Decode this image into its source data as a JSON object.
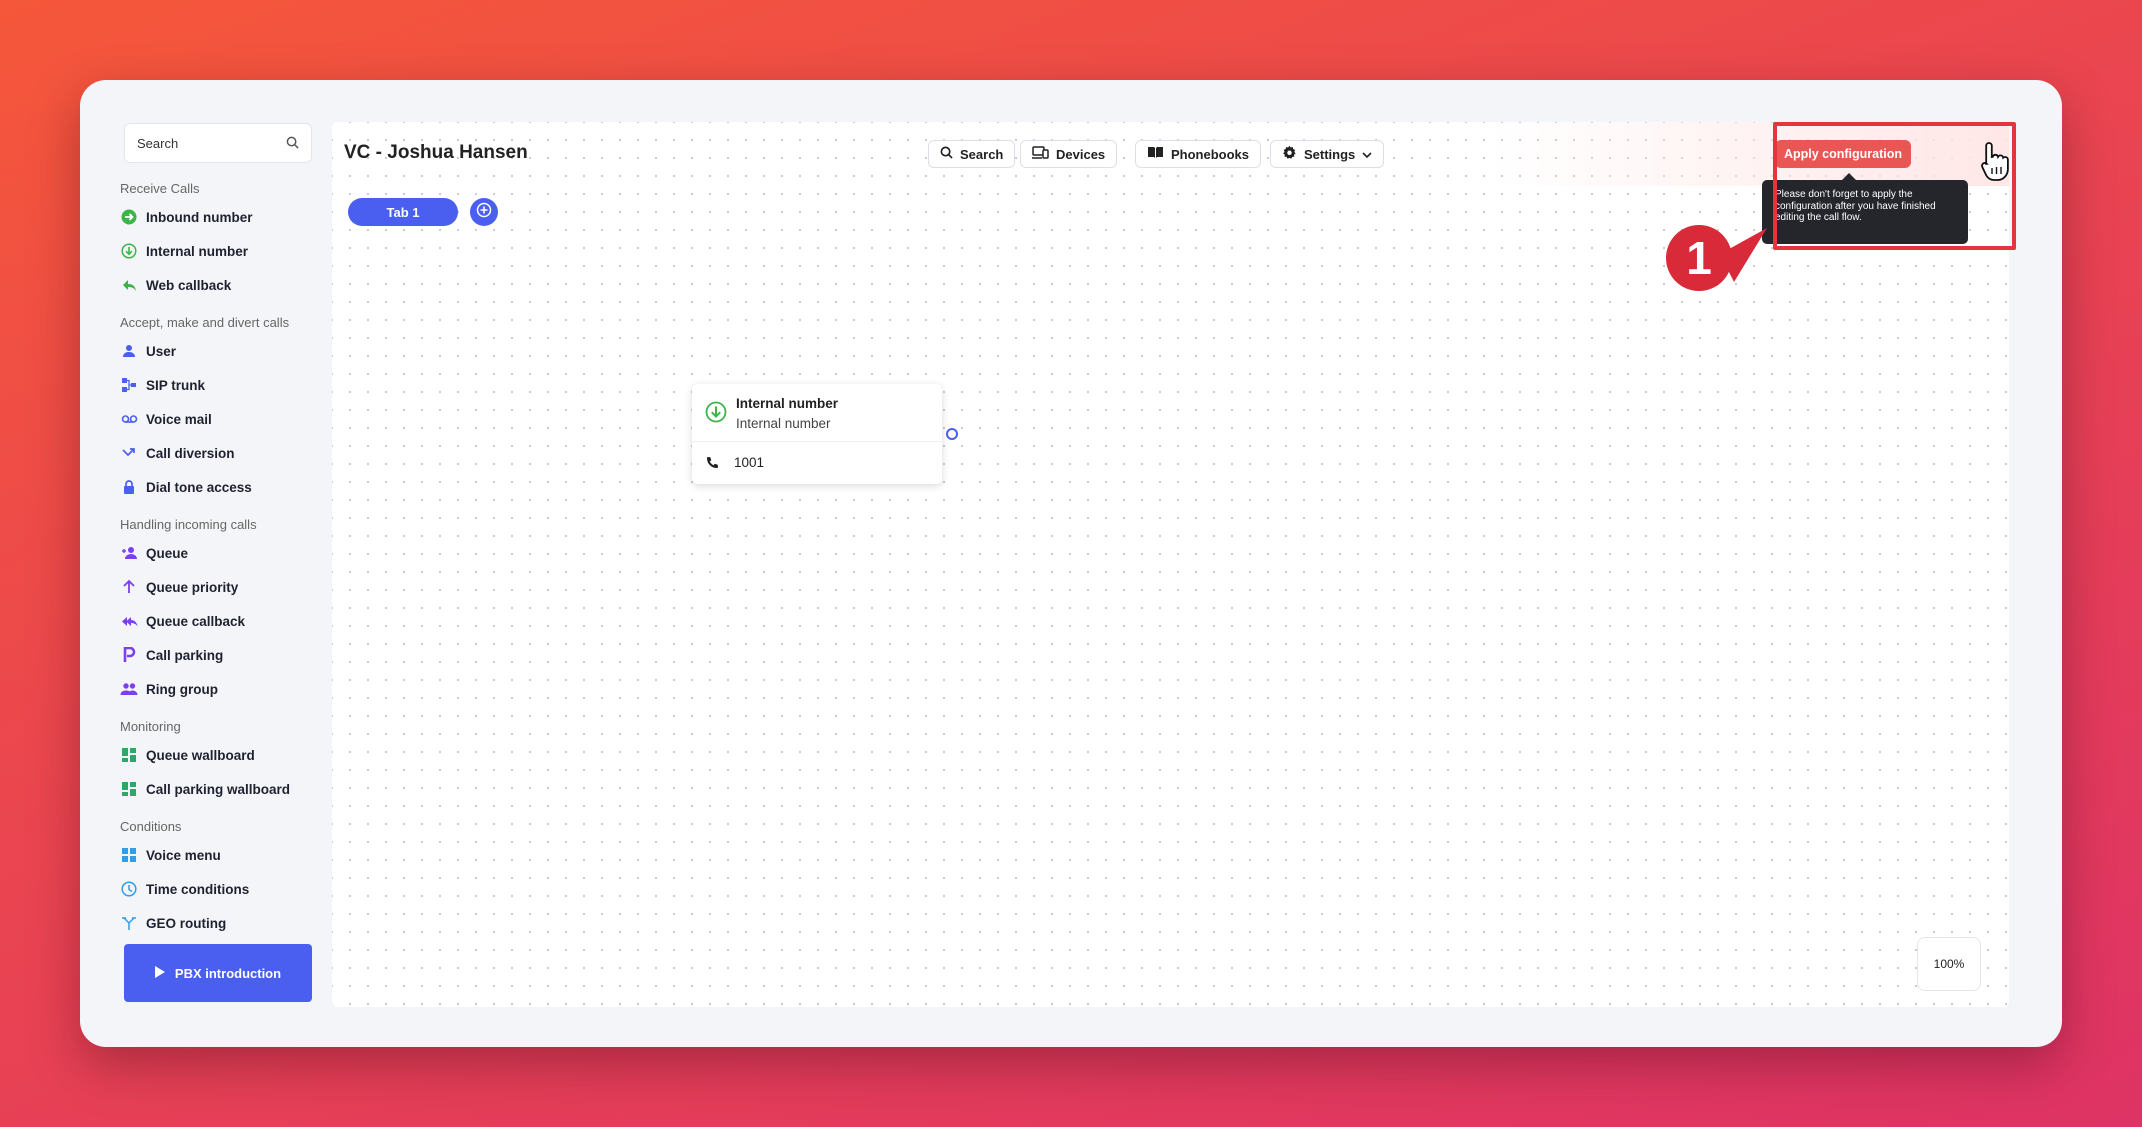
{
  "sidebar": {
    "search_placeholder": "Search",
    "sections": [
      {
        "title": "Receive Calls",
        "items": [
          {
            "label": "Inbound number",
            "icon": "inbound-icon"
          },
          {
            "label": "Internal number",
            "icon": "internal-number-icon"
          },
          {
            "label": "Web callback",
            "icon": "reply-icon"
          }
        ]
      },
      {
        "title": "Accept, make and divert calls",
        "items": [
          {
            "label": "User",
            "icon": "user-icon"
          },
          {
            "label": "SIP trunk",
            "icon": "sip-trunk-icon"
          },
          {
            "label": "Voice mail",
            "icon": "voicemail-icon"
          },
          {
            "label": "Call diversion",
            "icon": "call-diversion-icon"
          },
          {
            "label": "Dial tone access",
            "icon": "lock-icon"
          }
        ]
      },
      {
        "title": "Handling incoming calls",
        "items": [
          {
            "label": "Queue",
            "icon": "queue-icon"
          },
          {
            "label": "Queue priority",
            "icon": "arrow-up-icon"
          },
          {
            "label": "Queue callback",
            "icon": "queue-callback-icon"
          },
          {
            "label": "Call parking",
            "icon": "parking-icon"
          },
          {
            "label": "Ring group",
            "icon": "group-icon"
          }
        ]
      },
      {
        "title": "Monitoring",
        "items": [
          {
            "label": "Queue wallboard",
            "icon": "wallboard-icon"
          },
          {
            "label": "Call parking wallboard",
            "icon": "wallboard-icon"
          }
        ]
      },
      {
        "title": "Conditions",
        "items": [
          {
            "label": "Voice menu",
            "icon": "voice-menu-icon"
          },
          {
            "label": "Time conditions",
            "icon": "clock-icon"
          },
          {
            "label": "GEO routing",
            "icon": "geo-routing-icon"
          }
        ]
      }
    ],
    "pbx_button": "PBX introduction"
  },
  "header": {
    "title": "VC - Joshua Hansen",
    "search_label": "Search",
    "devices_label": "Devices",
    "phonebooks_label": "Phonebooks",
    "settings_label": "Settings",
    "apply_label": "Apply configuration"
  },
  "tooltip": {
    "text": "Please don't forget to apply the configuration after you have finished editing the call flow."
  },
  "tabs": [
    {
      "label": "Tab 1"
    }
  ],
  "node": {
    "title": "Internal number",
    "subtitle": "Internal number",
    "number": "1001"
  },
  "zoom": "100%",
  "callout": {
    "number": "1"
  },
  "colors": {
    "accent": "#4a5ff0",
    "apply": "#e95654",
    "highlight": "#e4353f",
    "green": "#3cb548"
  }
}
